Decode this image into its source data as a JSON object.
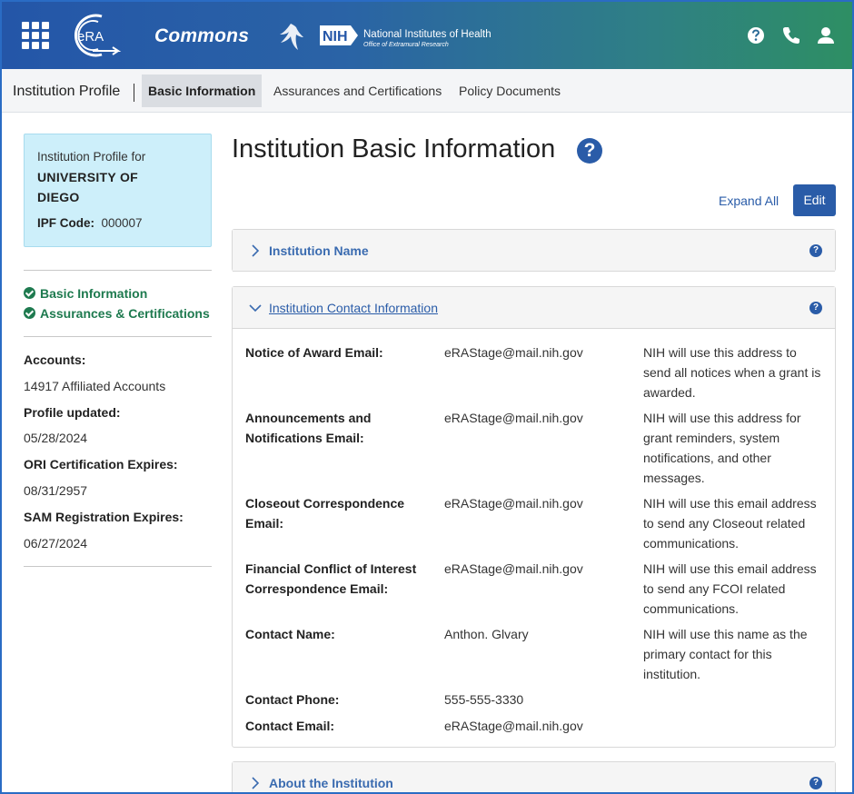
{
  "header": {
    "app_name": "Commons",
    "era_logo_text": "eRA",
    "nih_badge": "NIH",
    "nih_line1": "National Institutes of Health",
    "nih_line2": "Office of Extramural Research"
  },
  "subnav": {
    "title": "Institution Profile",
    "tabs": [
      {
        "label": "Basic Information",
        "active": true
      },
      {
        "label": "Assurances and Certifications",
        "active": false
      },
      {
        "label": "Policy Documents",
        "active": false
      }
    ]
  },
  "sidebar": {
    "profile_for": "Institution Profile for",
    "institution": "UNIVERSITY OF DIEGO",
    "ipf_label": "IPF Code:",
    "ipf_code": "000007",
    "checks": [
      "Basic Information",
      "Assurances & Certifications"
    ],
    "accounts_label": "Accounts:",
    "accounts_value": "14917 Affiliated Accounts",
    "profile_updated_label": "Profile updated:",
    "profile_updated_value": "05/28/2024",
    "ori_label": "ORI Certification Expires:",
    "ori_value": "08/31/2957",
    "sam_label": "SAM Registration Expires:",
    "sam_value": "06/27/2024"
  },
  "main": {
    "title": "Institution Basic Information",
    "expand_all": "Expand All",
    "edit": "Edit",
    "panels": [
      {
        "title": "Institution Name",
        "expanded": false
      },
      {
        "title": "Institution Contact Information",
        "expanded": true
      },
      {
        "title": "About the Institution",
        "expanded": false
      }
    ],
    "contact_rows": [
      {
        "label": "Notice of Award Email:",
        "value": "eRAStage@mail.nih.gov",
        "note": "NIH will use this address to send all notices when a grant is awarded."
      },
      {
        "label": "Announcements and Notifications Email:",
        "value": "eRAStage@mail.nih.gov",
        "note": "NIH will use this address for grant reminders, system notifications, and other messages."
      },
      {
        "label": "Closeout Correspondence Email:",
        "value": "eRAStage@mail.nih.gov",
        "note": "NIH will use this email address to send any Closeout related communications."
      },
      {
        "label": "Financial Conflict of Interest Correspondence Email:",
        "value": "eRAStage@mail.nih.gov",
        "note": "NIH will use this email address to send any FCOI related communications."
      },
      {
        "label": "Contact Name:",
        "value": "Anthon. Glvary",
        "note": "NIH will use this name as the primary contact for this institution."
      },
      {
        "label": "Contact Phone:",
        "value": "555-555-3330",
        "note": ""
      },
      {
        "label": "Contact Email:",
        "value": "eRAStage@mail.nih.gov",
        "note": ""
      }
    ]
  },
  "colors": {
    "accent": "#2a5ca8",
    "success": "#1e7a4f",
    "info_box": "#cdeffa"
  }
}
